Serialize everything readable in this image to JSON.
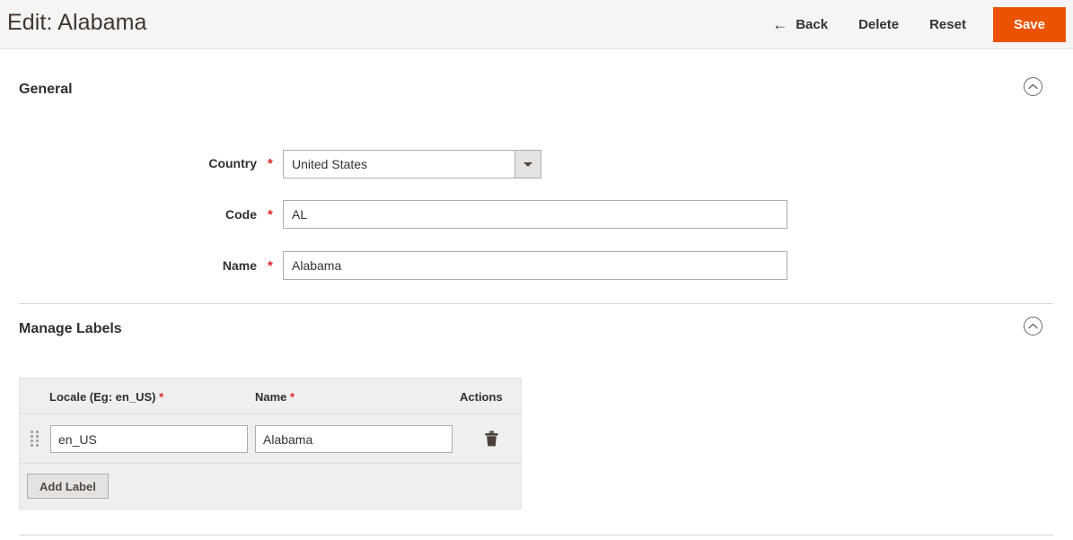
{
  "header": {
    "title": "Edit: Alabama",
    "back_label": "Back",
    "back_icon": "arrow-left-icon",
    "delete_label": "Delete",
    "reset_label": "Reset",
    "save_label": "Save",
    "save_color": "#eb5202"
  },
  "sections": {
    "general": {
      "title": "General",
      "collapse_icon": "chevron-up-circle-icon",
      "fields": {
        "country": {
          "label": "Country",
          "required_marker": "*",
          "value": "United States",
          "dropdown_icon": "chevron-down-icon"
        },
        "code": {
          "label": "Code",
          "required_marker": "*",
          "value": "AL",
          "placeholder": ""
        },
        "name": {
          "label": "Name",
          "required_marker": "*",
          "value": "Alabama",
          "placeholder": ""
        }
      }
    },
    "manage_labels": {
      "title": "Manage Labels",
      "collapse_icon": "chevron-up-circle-icon",
      "table": {
        "columns": [
          {
            "label": "Locale (Eg: en_US)",
            "required_marker": "*"
          },
          {
            "label": "Name",
            "required_marker": "*"
          },
          {
            "label": "Actions",
            "required_marker": ""
          }
        ],
        "rows": [
          {
            "drag_icon": "drag-handle-icon",
            "locale": "en_US",
            "name": "Alabama",
            "delete_icon": "trash-icon"
          }
        ],
        "add_button_label": "Add Label"
      }
    }
  }
}
